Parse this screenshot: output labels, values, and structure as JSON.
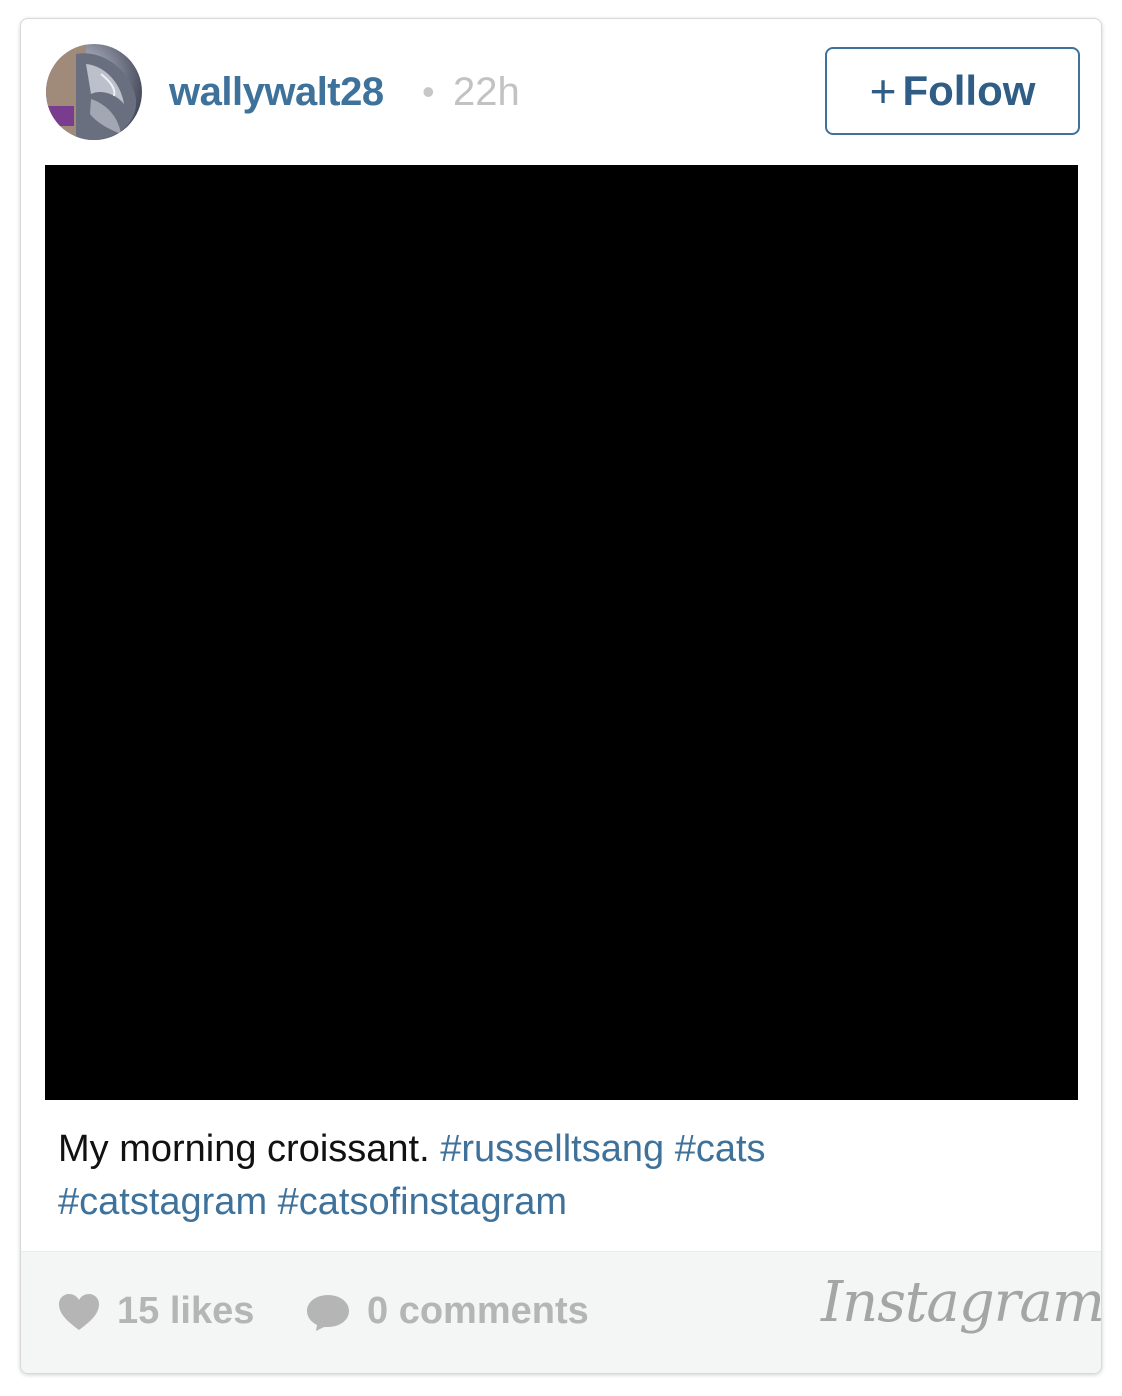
{
  "post": {
    "username": "wallywalt28",
    "separator": "•",
    "time_ago": "22h",
    "follow_label": "Follow",
    "follow_icon": "plus-icon",
    "caption": {
      "text": "My morning croissant.",
      "hashtags": [
        "#russelltsang",
        "#cats",
        "#catstagram",
        "#catsofinstagram"
      ]
    },
    "likes_label": "15 likes",
    "comments_label": "0 comments",
    "brand": "Instagram"
  },
  "colors": {
    "link_blue": "#3f729b",
    "muted_gray": "#b5b5b5",
    "footer_bg": "#f4f5f5",
    "photo_bg": "#000000"
  }
}
